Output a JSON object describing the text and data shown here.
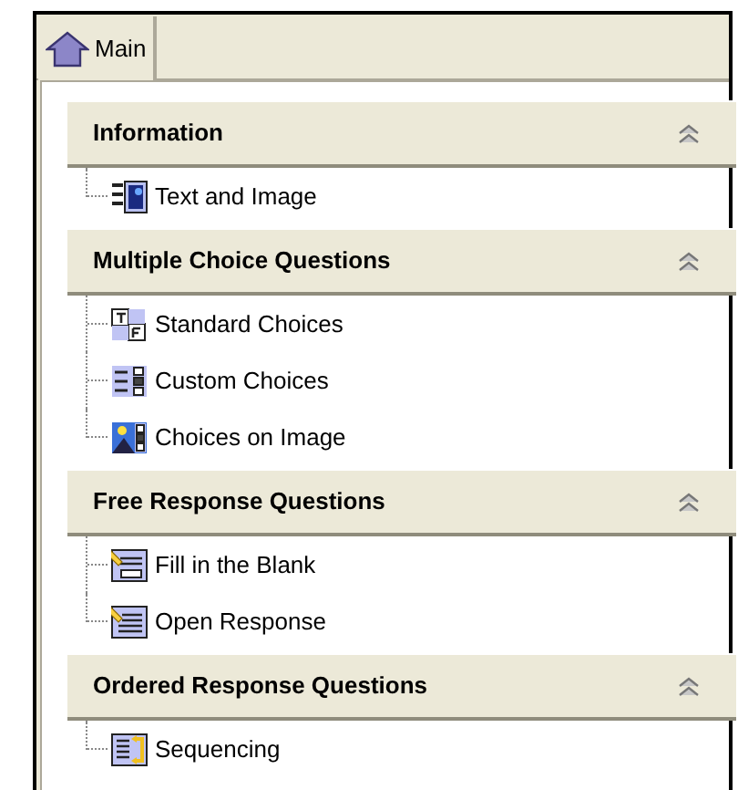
{
  "tabs": [
    {
      "label": "Main",
      "selected": true
    }
  ],
  "sections": [
    {
      "title": "Information",
      "expanded": true,
      "items": [
        {
          "label": "Text and Image"
        }
      ]
    },
    {
      "title": "Multiple Choice Questions",
      "expanded": true,
      "items": [
        {
          "label": "Standard Choices"
        },
        {
          "label": "Custom Choices"
        },
        {
          "label": "Choices on Image"
        }
      ]
    },
    {
      "title": "Free Response Questions",
      "expanded": true,
      "items": [
        {
          "label": "Fill in the Blank"
        },
        {
          "label": "Open Response"
        }
      ]
    },
    {
      "title": "Ordered Response Questions",
      "expanded": true,
      "items": [
        {
          "label": "Sequencing"
        }
      ]
    }
  ]
}
